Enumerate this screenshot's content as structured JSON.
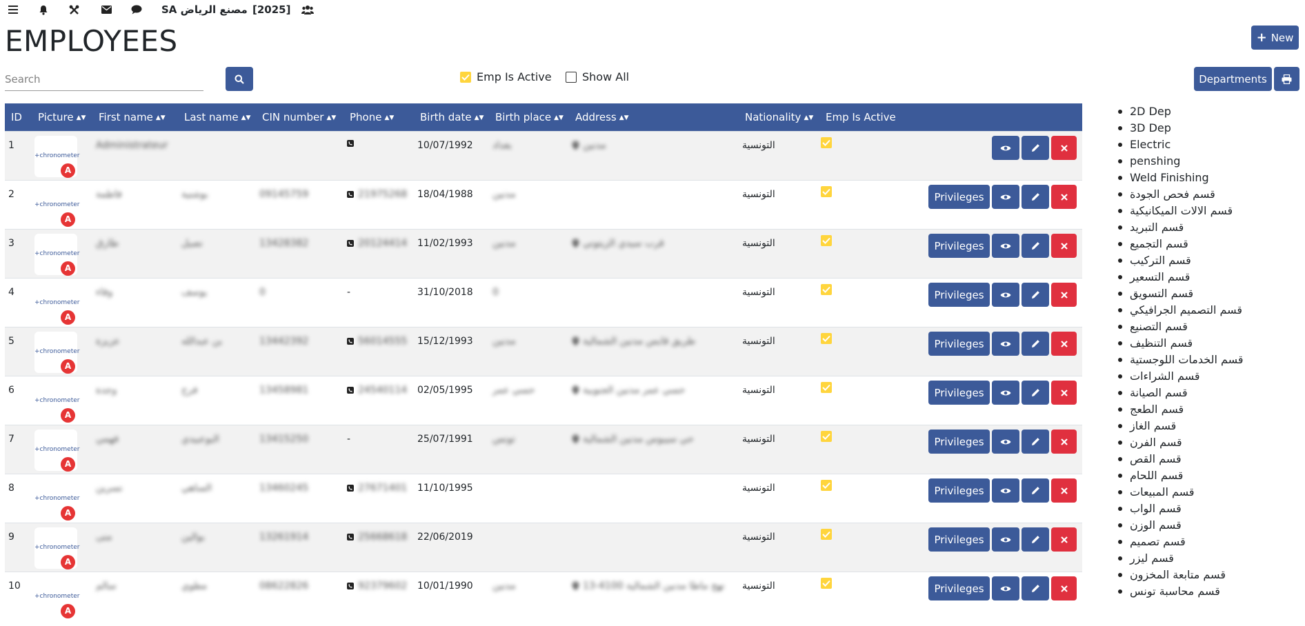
{
  "topbar": {
    "icons": [
      "menu-icon",
      "bell-icon",
      "tools-icon",
      "envelope-icon",
      "comments-icon",
      "users-icon"
    ],
    "company": "SA مصنع الرياض",
    "year": "[2025]"
  },
  "page": {
    "title": "EMPLOYEES"
  },
  "toolbar": {
    "new_label": "New",
    "departments_label": "Departments",
    "search_placeholder": "Search",
    "emp_is_active_label": "Emp Is Active",
    "show_all_label": "Show All",
    "emp_is_active_checked": true,
    "show_all_checked": false
  },
  "table": {
    "columns": [
      "ID",
      "Picture",
      "First name",
      "Last name",
      "CIN number",
      "Phone",
      "Birth date",
      "Birth place",
      "Address",
      "Nationality",
      "Emp Is Active"
    ],
    "privileges_label": "Privileges",
    "picture_logo": "+chronometer",
    "picture_badge": "A",
    "rows": [
      {
        "id": "1",
        "first": "Administrateur",
        "last": "",
        "cin": "",
        "phone": "",
        "phone_icon": true,
        "birth": "10/07/1992",
        "place": "بغداد",
        "address": "مدنين",
        "address_icon": true,
        "nationality": "التونسية",
        "active": true,
        "privileges": false
      },
      {
        "id": "2",
        "first": "فاطمة",
        "last": "بوشنية",
        "cin": "09145759",
        "phone": "21975268",
        "phone_icon": true,
        "birth": "18/04/1988",
        "place": "مدنين",
        "address": "",
        "address_icon": false,
        "nationality": "التونسية",
        "active": true,
        "privileges": true
      },
      {
        "id": "3",
        "first": "طارق",
        "last": "نصيل",
        "cin": "13428382",
        "phone": "20124414",
        "phone_icon": true,
        "birth": "11/02/1993",
        "place": "مدنين",
        "address": "قرب سيدي الزيتوني",
        "address_icon": true,
        "nationality": "التونسية",
        "active": true,
        "privileges": true
      },
      {
        "id": "4",
        "first": "وفاء",
        "last": "يوسف",
        "cin": "0",
        "phone": "-",
        "phone_icon": false,
        "birth": "31/10/2018",
        "place": "0",
        "address": "",
        "address_icon": false,
        "nationality": "التونسية",
        "active": true,
        "privileges": true
      },
      {
        "id": "5",
        "first": "عزيزة",
        "last": "بن عبدالله",
        "cin": "13442392",
        "phone": "56014555",
        "phone_icon": true,
        "birth": "15/12/1993",
        "place": "مدنين",
        "address": "طريق قابس مدنين الشمالية",
        "address_icon": true,
        "nationality": "التونسية",
        "active": true,
        "privileges": true
      },
      {
        "id": "6",
        "first": "وجدة",
        "last": "فرح",
        "cin": "13458981",
        "phone": "24540114",
        "phone_icon": true,
        "birth": "02/05/1995",
        "place": "حسي عمر",
        "address": "حسي عمر مدنين الجنوبية",
        "address_icon": true,
        "nationality": "التونسية",
        "active": true,
        "privileges": true
      },
      {
        "id": "7",
        "first": "فهمي",
        "last": "البوعبيدي",
        "cin": "13415250",
        "phone": "-",
        "phone_icon": false,
        "birth": "25/07/1991",
        "place": "تونس",
        "address": "حي سيبوس مدنين الشمالية",
        "address_icon": true,
        "nationality": "التونسية",
        "active": true,
        "privileges": true
      },
      {
        "id": "8",
        "first": "نسرين",
        "last": "الساهي",
        "cin": "13460245",
        "phone": "27671401",
        "phone_icon": true,
        "birth": "11/10/1995",
        "place": "",
        "address": "",
        "address_icon": false,
        "nationality": "التونسية",
        "active": true,
        "privileges": true
      },
      {
        "id": "9",
        "first": "منى",
        "last": "بوالين",
        "cin": "13261914",
        "phone": "25668618",
        "phone_icon": true,
        "birth": "22/06/2019",
        "place": "",
        "address": "",
        "address_icon": false,
        "nationality": "التونسية",
        "active": true,
        "privileges": true
      },
      {
        "id": "10",
        "first": "سالم",
        "last": "مطوي",
        "cin": "08622826",
        "phone": "92379602",
        "phone_icon": true,
        "birth": "10/01/1990",
        "place": "مدنين",
        "address": "نهج ماطا مدنين الشمالية 4100-13",
        "address_icon": true,
        "nationality": "التونسية",
        "active": true,
        "privileges": true
      }
    ]
  },
  "departments": [
    "2D Dep",
    "3D Dep",
    "Electric",
    "penshing",
    "Weld Finishing",
    "قسم فحص الجودة",
    "قسم الالات الميكانيكية",
    "قسم التبريد",
    "قسم التجميع",
    "قسم التركيب",
    "قسم التسعير",
    "قسم التسويق",
    "قسم التصميم الجرافيكي",
    "قسم التصنيع",
    "قسم التنظيف",
    "قسم الخدمات اللوجستية",
    "قسم الشراءات",
    "قسم الصيانة",
    "قسم الطعج",
    "قسم الغاز",
    "قسم الفرن",
    "قسم القص",
    "قسم اللحام",
    "قسم المبيعات",
    "قسم الواب",
    "قسم الوزن",
    "قسم تصميم",
    "قسم ليزر",
    "قسم متابعة المخزون",
    "قسم محاسبة تونس"
  ]
}
